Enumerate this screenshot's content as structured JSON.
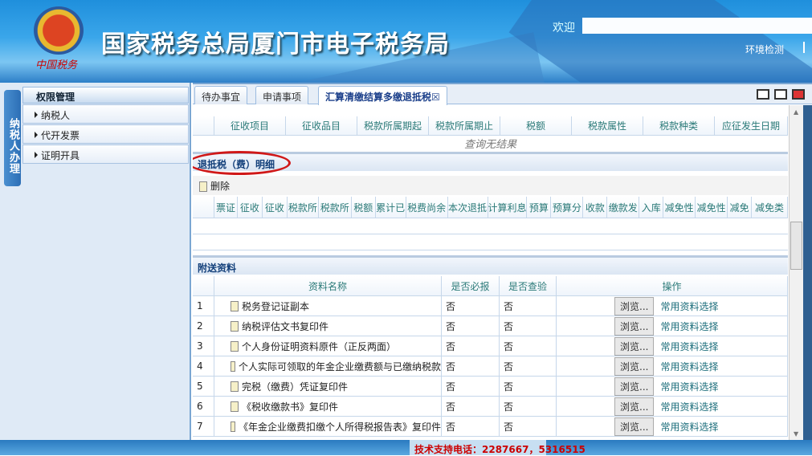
{
  "header": {
    "title": "国家税务总局厦门市电子税务局",
    "emblem_text": "中国税务",
    "welcome": "欢迎",
    "env_check": "环境检测"
  },
  "sidebar": {
    "vertical_tab": "纳税人办理",
    "panel_title": "权限管理",
    "items": [
      "纳税人",
      "代开发票",
      "证明开具"
    ]
  },
  "tabs": [
    "待办事宜",
    "申请事项",
    "汇算清缴结算多缴退抵税"
  ],
  "tab_close": "☒",
  "table1": {
    "headers": [
      "",
      "征收项目",
      "征收品目",
      "税款所属期起",
      "税款所属期止",
      "税额",
      "税款属性",
      "税款种类",
      "应征发生日期"
    ],
    "empty_text": "查询无结果"
  },
  "section_refund": {
    "title": "退抵税（费）明细",
    "delete_label": "删除",
    "headers": [
      "",
      "票证",
      "征收",
      "征收",
      "税款所",
      "税款所",
      "税额",
      "累计已",
      "税费尚余",
      "本次退抵",
      "计算利息",
      "预算",
      "预算分",
      "收款",
      "缴款发",
      "入库",
      "减免性",
      "减免性",
      "减免",
      "减免类"
    ]
  },
  "attachments": {
    "title": "附送资料",
    "headers": [
      "",
      "资料名称",
      "是否必报",
      "是否查验",
      "操作"
    ],
    "rows": [
      {
        "no": "1",
        "name": "税务登记证副本",
        "required": "否",
        "verified": "否"
      },
      {
        "no": "2",
        "name": "纳税评估文书复印件",
        "required": "否",
        "verified": "否"
      },
      {
        "no": "3",
        "name": "个人身份证明资料原件（正反两面）",
        "required": "否",
        "verified": "否"
      },
      {
        "no": "4",
        "name": "个人实际可领取的年金企业缴费额与已缴纳税款",
        "required": "否",
        "verified": "否"
      },
      {
        "no": "5",
        "name": "完税（缴费）凭证复印件",
        "required": "否",
        "verified": "否"
      },
      {
        "no": "6",
        "name": "《税收缴款书》复印件",
        "required": "否",
        "verified": "否"
      },
      {
        "no": "7",
        "name": "《年金企业缴费扣缴个人所得税报告表》复印件",
        "required": "否",
        "verified": "否"
      }
    ],
    "browse_label": "浏览...",
    "select_label": "常用资料选择"
  },
  "footer": {
    "support": "技术支持电话：2287667，5316515"
  }
}
